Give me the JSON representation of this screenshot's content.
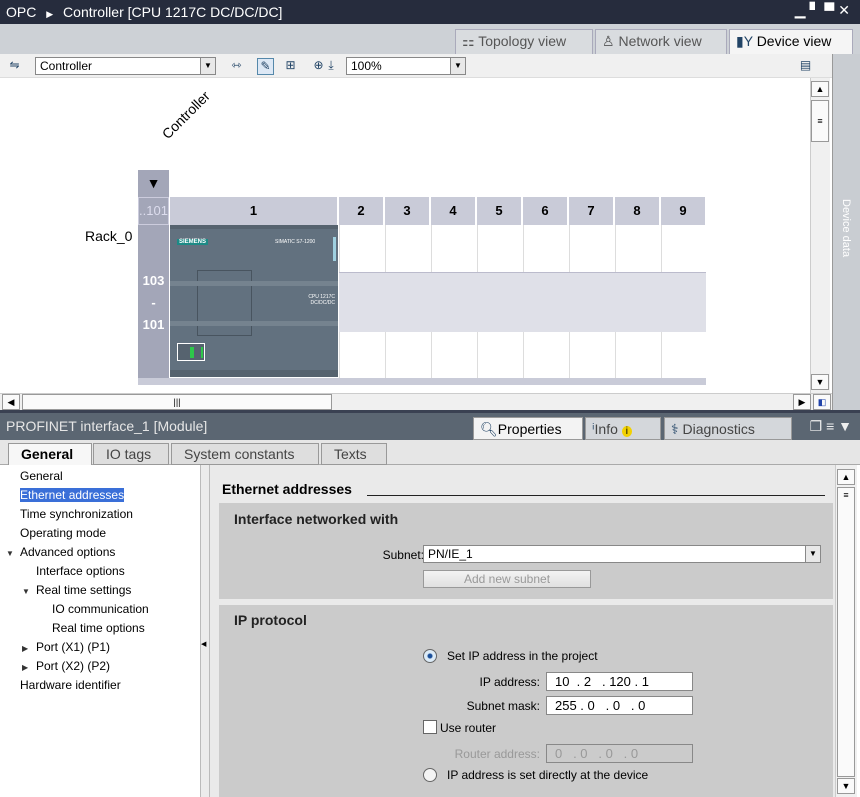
{
  "title": {
    "project": "OPC",
    "device": "Controller [CPU 1217C DC/DC/DC]"
  },
  "view_tabs": [
    {
      "label": "Topology view",
      "icon": "topology-icon"
    },
    {
      "label": "Network view",
      "icon": "network-icon"
    },
    {
      "label": "Device view",
      "icon": "device-icon",
      "active": true
    }
  ],
  "toolbar": {
    "device_select": "Controller",
    "zoom": "100%"
  },
  "canvas": {
    "device_label": "Controller",
    "rack_label": "Rack_0",
    "rack_header": "..101",
    "slots": [
      "1",
      "2",
      "3",
      "4",
      "5",
      "6",
      "7",
      "8",
      "9"
    ],
    "row_labels": [
      "103",
      "-",
      "101"
    ],
    "module_brand": "SIEMENS",
    "module_model": "SIMATIC S7-1200",
    "module_cpu": "CPU 1217C DC/DC/DC"
  },
  "device_data_panel": "Device data",
  "inspector": {
    "title": "PROFINET interface_1 [Module]",
    "tabs": [
      {
        "label": "Properties",
        "active": true
      },
      {
        "label": "Info"
      },
      {
        "label": "Diagnostics"
      }
    ]
  },
  "prop_tabs": [
    {
      "label": "General",
      "active": true
    },
    {
      "label": "IO tags"
    },
    {
      "label": "System constants"
    },
    {
      "label": "Texts"
    }
  ],
  "nav": [
    {
      "label": "General",
      "level": 0
    },
    {
      "label": "Ethernet addresses",
      "level": 0,
      "selected": true
    },
    {
      "label": "Time synchronization",
      "level": 0
    },
    {
      "label": "Operating mode",
      "level": 0
    },
    {
      "label": "Advanced options",
      "level": 0,
      "expander": "expanded"
    },
    {
      "label": "Interface options",
      "level": 1
    },
    {
      "label": "Real time settings",
      "level": 1,
      "expander": "expanded"
    },
    {
      "label": "IO communication",
      "level": 2
    },
    {
      "label": "Real time options",
      "level": 2
    },
    {
      "label": "Port (X1) (P1)",
      "level": 1,
      "expander": "collapsed"
    },
    {
      "label": "Port (X2) (P2)",
      "level": 1,
      "expander": "collapsed"
    },
    {
      "label": "Hardware identifier",
      "level": 0
    }
  ],
  "content": {
    "heading": "Ethernet addresses",
    "interface": {
      "title": "Interface networked with",
      "subnet_label": "Subnet:",
      "subnet_value": "PN/IE_1",
      "add_subnet": "Add new subnet"
    },
    "ip": {
      "title": "IP protocol",
      "radio_project": "Set IP address in the project",
      "radio_project_checked": true,
      "ip_label": "IP address:",
      "ip_value": "10  . 2   . 120 . 1",
      "mask_label": "Subnet mask:",
      "mask_value": "255 . 0   . 0   . 0",
      "use_router": "Use router",
      "use_router_checked": false,
      "router_label": "Router address:",
      "router_value": "0   . 0   . 0   . 0",
      "radio_device": "IP address is set directly at the device"
    }
  }
}
